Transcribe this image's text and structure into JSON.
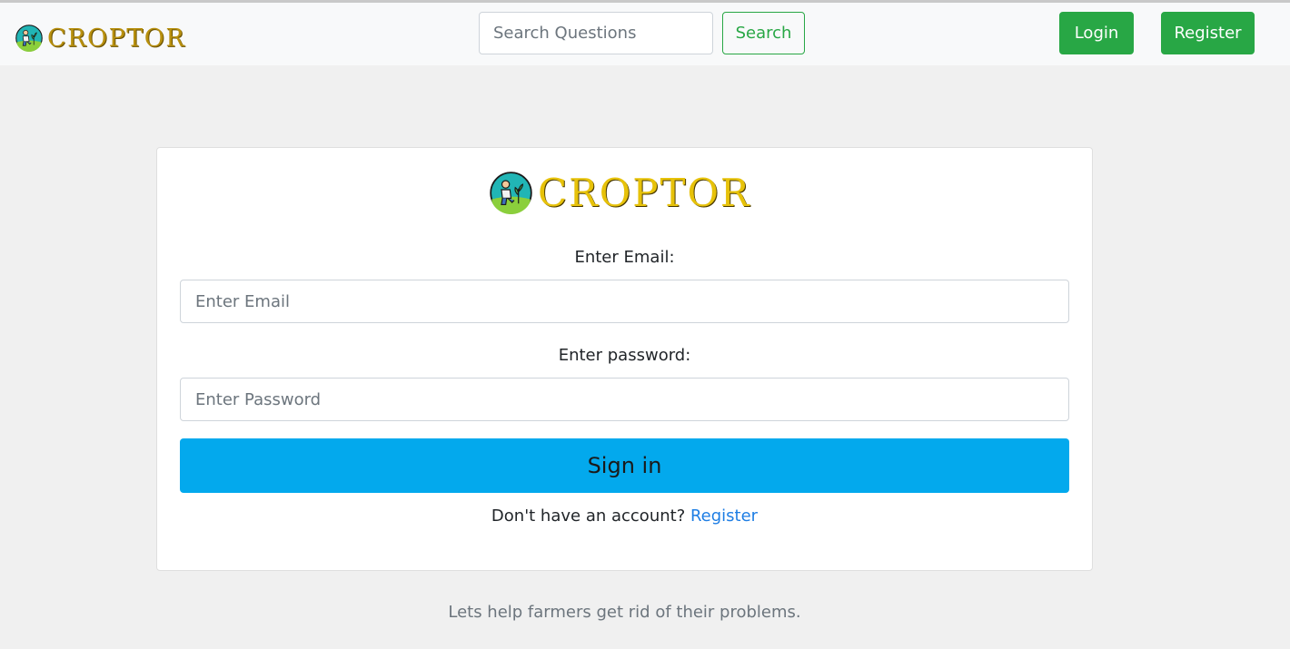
{
  "brand": {
    "name": "CROPTOR",
    "logo_icon": "farmer-planting-icon"
  },
  "navbar": {
    "search_placeholder": "Search Questions",
    "search_label": "Search",
    "login_label": "Login",
    "register_label": "Register"
  },
  "form": {
    "email_label": "Enter Email:",
    "email_placeholder": "Enter Email",
    "password_label": "Enter password:",
    "password_placeholder": "Enter Password",
    "signin_label": "Sign in",
    "no_account_text": "Don't have an account? ",
    "register_link": "Register"
  },
  "footer": {
    "tagline": "Lets help farmers get rid of their problems."
  },
  "colors": {
    "brand_green": "#28a745",
    "signin_blue": "#03a9ed",
    "link_blue": "#1e7ee4",
    "logo_gold": "#e7c20a"
  }
}
